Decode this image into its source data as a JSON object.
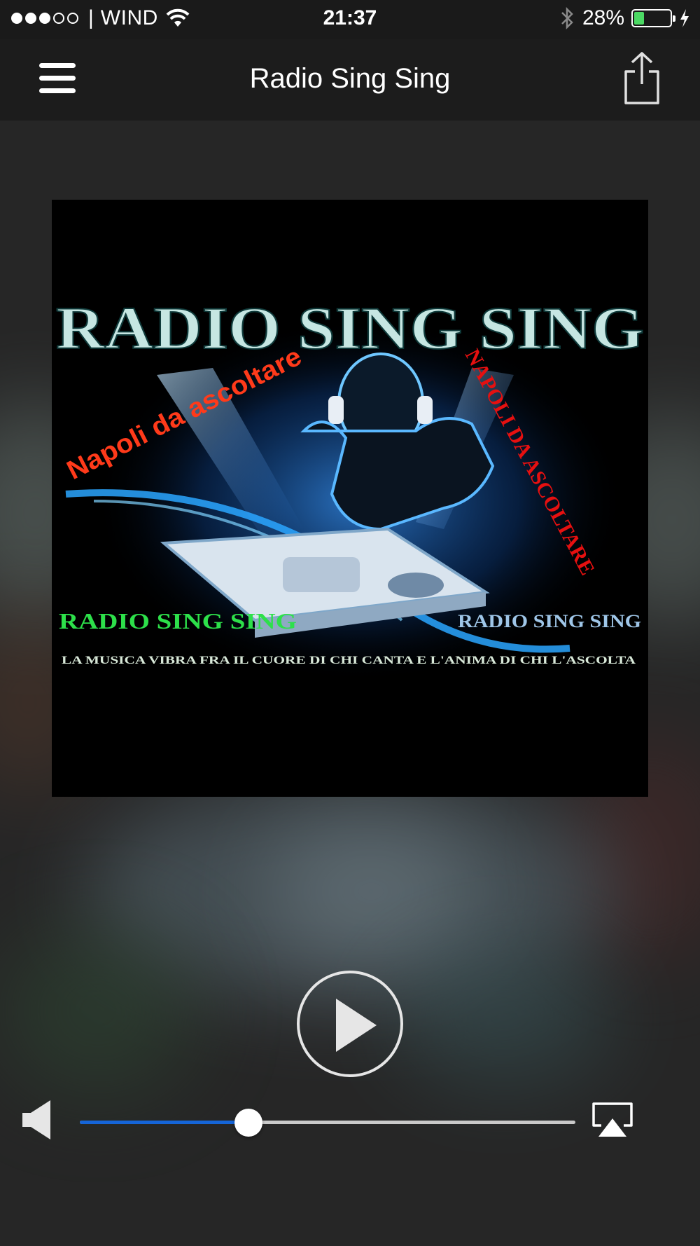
{
  "status_bar": {
    "carrier": "WIND",
    "time": "21:37",
    "battery_percent_label": "28%",
    "battery_level": 0.28,
    "signal_bars_filled": 3,
    "signal_bars_total": 5
  },
  "nav": {
    "title": "Radio Sing Sing",
    "menu_icon": "hamburger-menu-icon",
    "share_icon": "share-icon"
  },
  "artwork": {
    "headline": "RADIO SING SING",
    "slogan_left": "Napoli da ascoltare",
    "slogan_right": "NAPOLI DA ASCOLTARE",
    "label_left": "RADIO SING SING",
    "label_right": "RADIO SING SING",
    "tagline": "LA MUSICA VIBRA FRA IL CUORE DI CHI CANTA E L'ANIMA DI CHI L'ASCOLTA"
  },
  "player": {
    "play_icon": "play-icon",
    "volume_icon": "speaker-icon",
    "airplay_icon": "airplay-icon",
    "volume_level": 0.34,
    "colors": {
      "volume_fill": "#1565d8",
      "track": "#c9c9c9",
      "battery": "#4cd964"
    }
  }
}
